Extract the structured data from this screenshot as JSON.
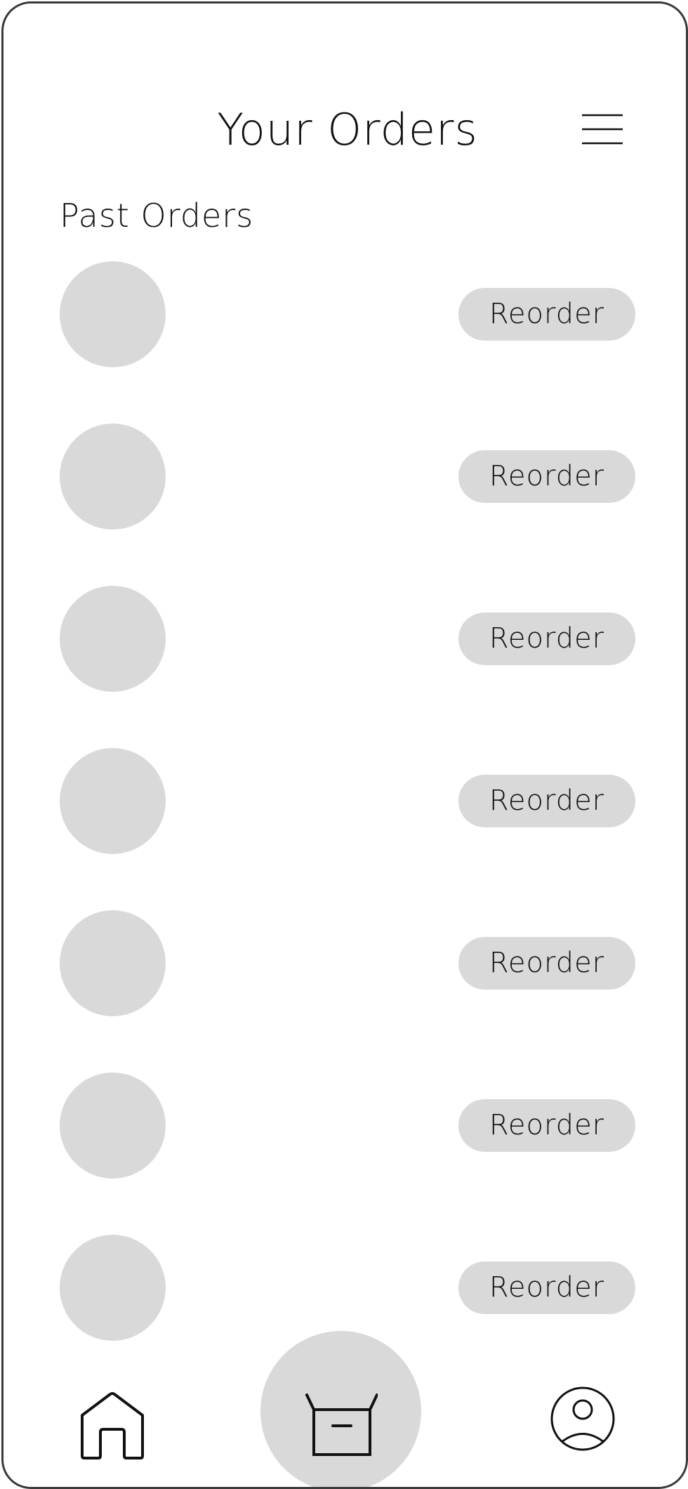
{
  "header": {
    "title": "Your Orders",
    "menu_icon": "hamburger-menu-icon"
  },
  "orders": {
    "section_title": "Past Orders",
    "items": [
      {
        "reorder_label": "Reorder"
      },
      {
        "reorder_label": "Reorder"
      },
      {
        "reorder_label": "Reorder"
      },
      {
        "reorder_label": "Reorder"
      },
      {
        "reorder_label": "Reorder"
      },
      {
        "reorder_label": "Reorder"
      },
      {
        "reorder_label": "Reorder"
      }
    ]
  },
  "bottom_nav": {
    "items": [
      {
        "icon": "home-icon",
        "active": false
      },
      {
        "icon": "box-icon",
        "active": true
      },
      {
        "icon": "profile-icon",
        "active": false
      }
    ]
  },
  "colors": {
    "placeholder": "#d9d9d9",
    "frame_border": "#3a3a3a",
    "text": "#111111",
    "background": "#ffffff"
  }
}
